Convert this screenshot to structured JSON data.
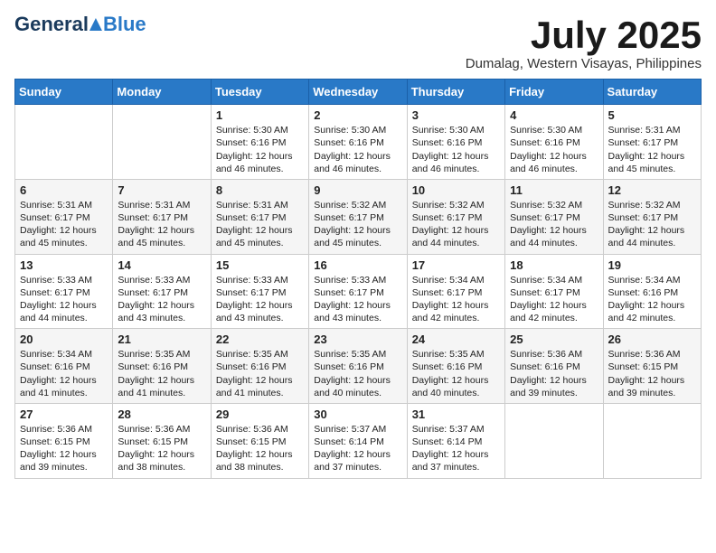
{
  "header": {
    "logo": {
      "general": "General",
      "blue": "Blue"
    },
    "title": "July 2025",
    "location": "Dumalag, Western Visayas, Philippines"
  },
  "days_header": [
    "Sunday",
    "Monday",
    "Tuesday",
    "Wednesday",
    "Thursday",
    "Friday",
    "Saturday"
  ],
  "weeks": [
    [
      {
        "day": "",
        "text": ""
      },
      {
        "day": "",
        "text": ""
      },
      {
        "day": "1",
        "text": "Sunrise: 5:30 AM\nSunset: 6:16 PM\nDaylight: 12 hours and 46 minutes."
      },
      {
        "day": "2",
        "text": "Sunrise: 5:30 AM\nSunset: 6:16 PM\nDaylight: 12 hours and 46 minutes."
      },
      {
        "day": "3",
        "text": "Sunrise: 5:30 AM\nSunset: 6:16 PM\nDaylight: 12 hours and 46 minutes."
      },
      {
        "day": "4",
        "text": "Sunrise: 5:30 AM\nSunset: 6:16 PM\nDaylight: 12 hours and 46 minutes."
      },
      {
        "day": "5",
        "text": "Sunrise: 5:31 AM\nSunset: 6:17 PM\nDaylight: 12 hours and 45 minutes."
      }
    ],
    [
      {
        "day": "6",
        "text": "Sunrise: 5:31 AM\nSunset: 6:17 PM\nDaylight: 12 hours and 45 minutes."
      },
      {
        "day": "7",
        "text": "Sunrise: 5:31 AM\nSunset: 6:17 PM\nDaylight: 12 hours and 45 minutes."
      },
      {
        "day": "8",
        "text": "Sunrise: 5:31 AM\nSunset: 6:17 PM\nDaylight: 12 hours and 45 minutes."
      },
      {
        "day": "9",
        "text": "Sunrise: 5:32 AM\nSunset: 6:17 PM\nDaylight: 12 hours and 45 minutes."
      },
      {
        "day": "10",
        "text": "Sunrise: 5:32 AM\nSunset: 6:17 PM\nDaylight: 12 hours and 44 minutes."
      },
      {
        "day": "11",
        "text": "Sunrise: 5:32 AM\nSunset: 6:17 PM\nDaylight: 12 hours and 44 minutes."
      },
      {
        "day": "12",
        "text": "Sunrise: 5:32 AM\nSunset: 6:17 PM\nDaylight: 12 hours and 44 minutes."
      }
    ],
    [
      {
        "day": "13",
        "text": "Sunrise: 5:33 AM\nSunset: 6:17 PM\nDaylight: 12 hours and 44 minutes."
      },
      {
        "day": "14",
        "text": "Sunrise: 5:33 AM\nSunset: 6:17 PM\nDaylight: 12 hours and 43 minutes."
      },
      {
        "day": "15",
        "text": "Sunrise: 5:33 AM\nSunset: 6:17 PM\nDaylight: 12 hours and 43 minutes."
      },
      {
        "day": "16",
        "text": "Sunrise: 5:33 AM\nSunset: 6:17 PM\nDaylight: 12 hours and 43 minutes."
      },
      {
        "day": "17",
        "text": "Sunrise: 5:34 AM\nSunset: 6:17 PM\nDaylight: 12 hours and 42 minutes."
      },
      {
        "day": "18",
        "text": "Sunrise: 5:34 AM\nSunset: 6:17 PM\nDaylight: 12 hours and 42 minutes."
      },
      {
        "day": "19",
        "text": "Sunrise: 5:34 AM\nSunset: 6:16 PM\nDaylight: 12 hours and 42 minutes."
      }
    ],
    [
      {
        "day": "20",
        "text": "Sunrise: 5:34 AM\nSunset: 6:16 PM\nDaylight: 12 hours and 41 minutes."
      },
      {
        "day": "21",
        "text": "Sunrise: 5:35 AM\nSunset: 6:16 PM\nDaylight: 12 hours and 41 minutes."
      },
      {
        "day": "22",
        "text": "Sunrise: 5:35 AM\nSunset: 6:16 PM\nDaylight: 12 hours and 41 minutes."
      },
      {
        "day": "23",
        "text": "Sunrise: 5:35 AM\nSunset: 6:16 PM\nDaylight: 12 hours and 40 minutes."
      },
      {
        "day": "24",
        "text": "Sunrise: 5:35 AM\nSunset: 6:16 PM\nDaylight: 12 hours and 40 minutes."
      },
      {
        "day": "25",
        "text": "Sunrise: 5:36 AM\nSunset: 6:16 PM\nDaylight: 12 hours and 39 minutes."
      },
      {
        "day": "26",
        "text": "Sunrise: 5:36 AM\nSunset: 6:15 PM\nDaylight: 12 hours and 39 minutes."
      }
    ],
    [
      {
        "day": "27",
        "text": "Sunrise: 5:36 AM\nSunset: 6:15 PM\nDaylight: 12 hours and 39 minutes."
      },
      {
        "day": "28",
        "text": "Sunrise: 5:36 AM\nSunset: 6:15 PM\nDaylight: 12 hours and 38 minutes."
      },
      {
        "day": "29",
        "text": "Sunrise: 5:36 AM\nSunset: 6:15 PM\nDaylight: 12 hours and 38 minutes."
      },
      {
        "day": "30",
        "text": "Sunrise: 5:37 AM\nSunset: 6:14 PM\nDaylight: 12 hours and 37 minutes."
      },
      {
        "day": "31",
        "text": "Sunrise: 5:37 AM\nSunset: 6:14 PM\nDaylight: 12 hours and 37 minutes."
      },
      {
        "day": "",
        "text": ""
      },
      {
        "day": "",
        "text": ""
      }
    ]
  ]
}
